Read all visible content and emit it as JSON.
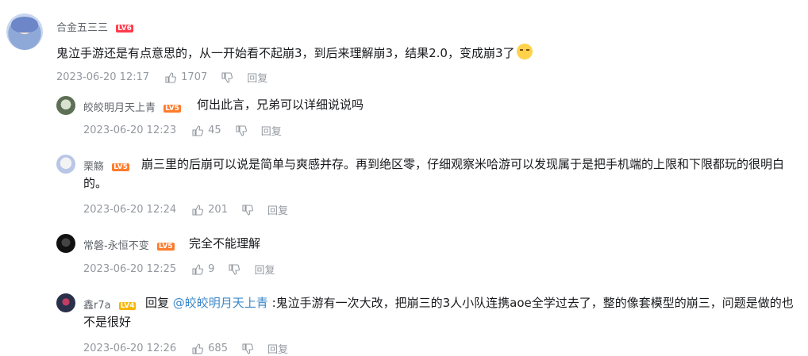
{
  "main_comment": {
    "username": "合金五三三",
    "level": "LV6",
    "text": "鬼泣手游还是有点意思的，从一开始看不起崩3，到后来理解崩3，结果2.0，变成崩3了",
    "emoji_icon": "slight-smile-emoji",
    "time": "2023-06-20 12:17",
    "likes": "1707",
    "reply_label": "回复"
  },
  "replies": [
    {
      "username": "皎皎明月天上青",
      "level": "LV5",
      "text": "何出此言，兄弟可以详细说说吗",
      "time": "2023-06-20 12:23",
      "likes": "45",
      "reply_label": "回复"
    },
    {
      "username": "栗觞",
      "level": "LV5",
      "text": "崩三里的后崩可以说是简单与爽感并存。再到绝区零，仔细观察米哈游可以发现属于是把手机端的上限和下限都玩的很明白的。",
      "time": "2023-06-20 12:24",
      "likes": "201",
      "reply_label": "回复"
    },
    {
      "username": "常磐-永恒不变",
      "level": "LV5",
      "text": "完全不能理解",
      "time": "2023-06-20 12:25",
      "likes": "9",
      "reply_label": "回复"
    },
    {
      "username": "鑫r7a",
      "level": "LV4",
      "prefix": "回复 ",
      "mention": "@皎皎明月天上青",
      "text": " :鬼泣手游有一次大改，把崩三的3人小队连携aoe全学过去了，整的像套模型的崩三，问题是做的也不是很好",
      "time": "2023-06-20 12:26",
      "likes": "685",
      "reply_label": "回复"
    }
  ],
  "colors": {
    "lv6": "#ff3b4a",
    "lv5": "#ff7b2c",
    "lv4": "#f7b500",
    "mention": "#3d88c8",
    "meta": "#9499a0"
  }
}
